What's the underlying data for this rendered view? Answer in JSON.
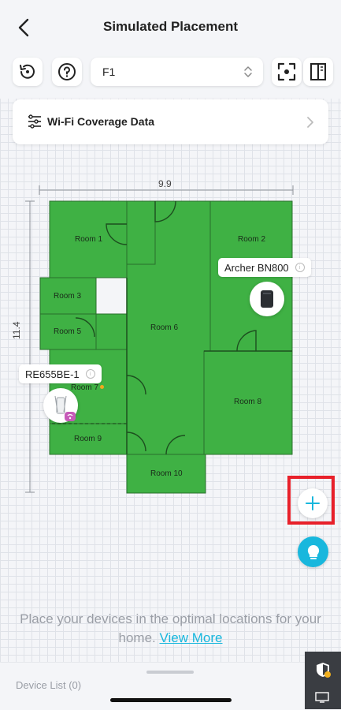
{
  "header": {
    "title": "Simulated Placement",
    "floor": "F1"
  },
  "coverage": {
    "label": "Wi-Fi Coverage Data"
  },
  "floor_plan": {
    "width_label": "9.9",
    "height_label": "11.4",
    "rooms": [
      "Room 1",
      "Room 2",
      "Room 3",
      "Room 5",
      "Room 6",
      "Room 7",
      "Room 8",
      "Room 9",
      "Room 10"
    ]
  },
  "devices": {
    "router_name": "Archer BN800",
    "extender_name": "RE655BE-1"
  },
  "hint": {
    "text": "Place your devices in the optimal locations for your home.",
    "link": "View More"
  },
  "bottom": {
    "device_list": "Device List (0)"
  },
  "colors": {
    "coverage_green": "#3fb144",
    "accent": "#18b7dd",
    "highlight": "#e8202a"
  }
}
